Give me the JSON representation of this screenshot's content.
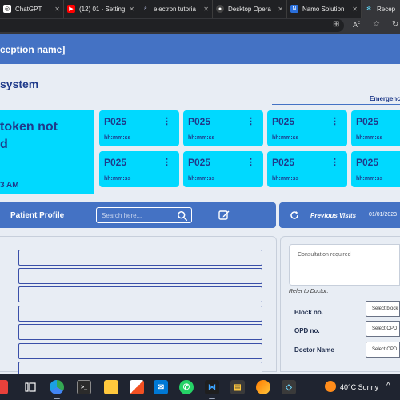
{
  "browser": {
    "tabs": [
      {
        "label": "ChatGPT",
        "icon": "chatgpt-icon"
      },
      {
        "label": "(12) 01 - Setting",
        "icon": "youtube-icon"
      },
      {
        "label": "electron tutoria",
        "icon": "search-icon"
      },
      {
        "label": "Desktop Opera",
        "icon": "github-icon"
      },
      {
        "label": "Namo Solution",
        "icon": "namo-icon"
      },
      {
        "label": "Recep",
        "icon": "react-icon"
      }
    ],
    "active_tab_index": 5
  },
  "app": {
    "header_title": "ception name]",
    "system_title": "system",
    "emergency_label": "Emergenc"
  },
  "token": {
    "message_line1": "token not",
    "message_line2": "d",
    "time": "3 AM"
  },
  "queue": {
    "cards": [
      {
        "id": "P025",
        "time": "hh:mm:ss"
      },
      {
        "id": "P025",
        "time": "hh:mm:ss"
      },
      {
        "id": "P025",
        "time": "hh:mm:ss"
      },
      {
        "id": "P025",
        "time": "hh:mm:ss"
      },
      {
        "id": "P025",
        "time": "hh:mm:ss"
      },
      {
        "id": "P025",
        "time": "hh:mm:ss"
      },
      {
        "id": "P025",
        "time": "hh:mm:ss"
      },
      {
        "id": "P025",
        "time": "hh:mm:ss"
      }
    ],
    "menu_glyph": "⋮"
  },
  "profile": {
    "title": "Patient Profile",
    "search_placeholder": "Search here..."
  },
  "visits": {
    "title": "Previous Visits",
    "date": "01/01/2023"
  },
  "consultation": {
    "placeholder": "Consultation required",
    "refer_label": "Refer to Doctor:",
    "fields": [
      {
        "label": "Block no.",
        "select_value": "Select block"
      },
      {
        "label": "OPD no.",
        "select_value": "Select OPD"
      },
      {
        "label": "Doctor Name",
        "select_value": "Select OPD"
      }
    ]
  },
  "taskbar": {
    "weather": "40°C  Sunny",
    "chevron": "^"
  },
  "colors": {
    "header_blue": "#4472c4",
    "card_cyan": "#00d9ff",
    "text_navy": "#1f3a8a",
    "page_bg": "#e8edf4"
  }
}
